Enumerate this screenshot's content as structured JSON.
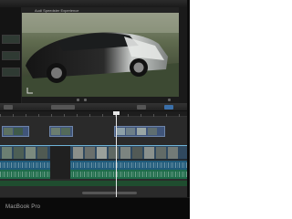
{
  "device": {
    "brand_label": "MacBook Pro"
  },
  "viewer": {
    "title": "Audi Speedster Experience",
    "icons": [
      "play-icon",
      "fullscreen-icon"
    ]
  },
  "timeline": {
    "primary_clip_count": 13,
    "connected_clip_count": 3
  },
  "colors": {
    "primary_storyline": "#30495f",
    "audio_lane": "#1f5a7a",
    "music_lane": "#1e6c4a",
    "selection": "#6fb4d8",
    "background": "#ffffff"
  }
}
